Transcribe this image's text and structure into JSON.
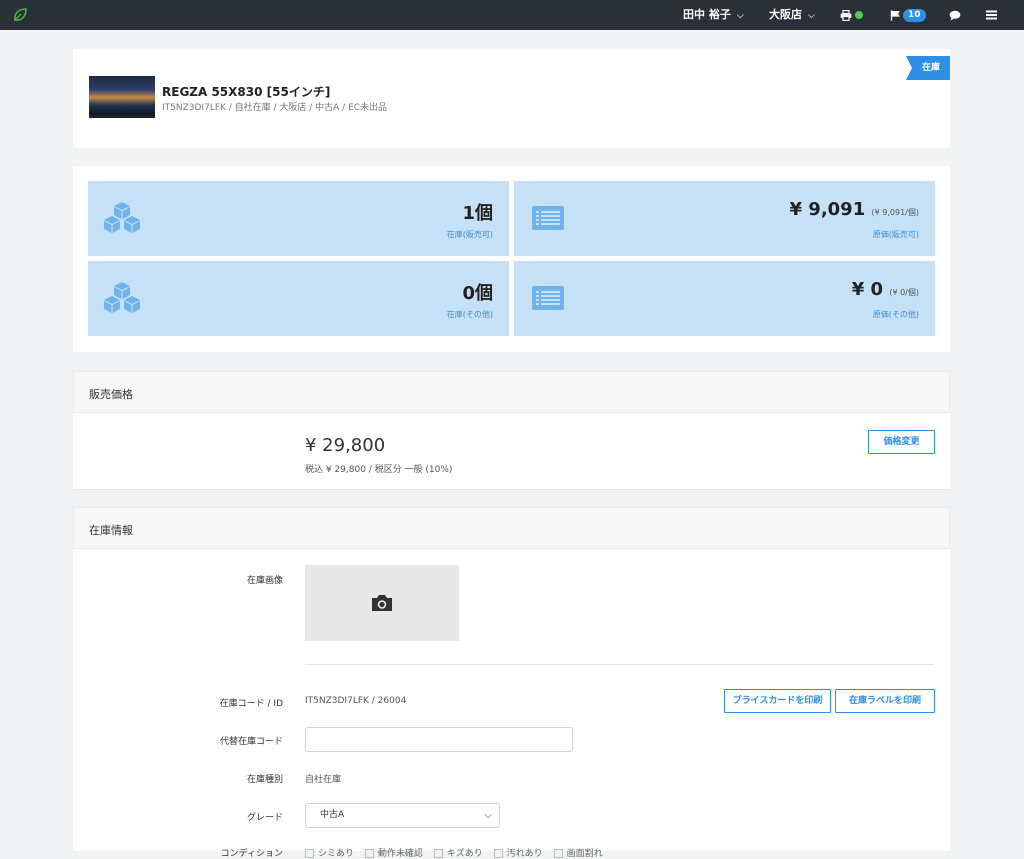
{
  "topbar": {
    "user_name": "田中 裕子",
    "store": "大阪店",
    "notification_count": "10",
    "colors": {
      "bar": "#2b2f36",
      "accent": "#2e8fe6",
      "status_ok": "#4cd34c"
    }
  },
  "product": {
    "title": "REGZA 55X830 [55インチ]",
    "subtitle": "IT5NZ3DI7LFK / 自社在庫 / 大阪店 / 中古A / EC未出品",
    "status_ribbon": "在庫"
  },
  "stats": {
    "stock_sellable": {
      "value": "1個",
      "label": "在庫(販売可)"
    },
    "cost_sellable": {
      "value": "¥ 9,091",
      "unit_note": "(¥ 9,091/個)",
      "label": "原価(販売可)"
    },
    "stock_other": {
      "value": "0個",
      "label": "在庫(その他)"
    },
    "cost_other": {
      "value": "¥ 0",
      "unit_note": "(¥ 0/個)",
      "label": "原価(その他)"
    }
  },
  "sales_price": {
    "section_title": "販売価格",
    "price": "¥ 29,800",
    "detail": "税込 ¥ 29,800 / 税区分 一般 (10%)",
    "change_button": "価格変更"
  },
  "stock_info": {
    "section_title": "在庫情報",
    "image_label": "在庫画像",
    "code_label": "在庫コード / ID",
    "code_value": "IT5NZ3DI7LFK / 26004",
    "print_price_card": "プライスカードを印刷",
    "print_stock_label": "在庫ラベルを印刷",
    "alt_code_label": "代替在庫コード",
    "alt_code_value": "",
    "type_label": "在庫種別",
    "type_value": "自社在庫",
    "grade_label": "グレード",
    "grade_value": "中古A",
    "condition_label": "コンディション",
    "conditions": [
      "シミあり",
      "動作未確認",
      "キズあり",
      "汚れあり",
      "画面割れ"
    ]
  }
}
